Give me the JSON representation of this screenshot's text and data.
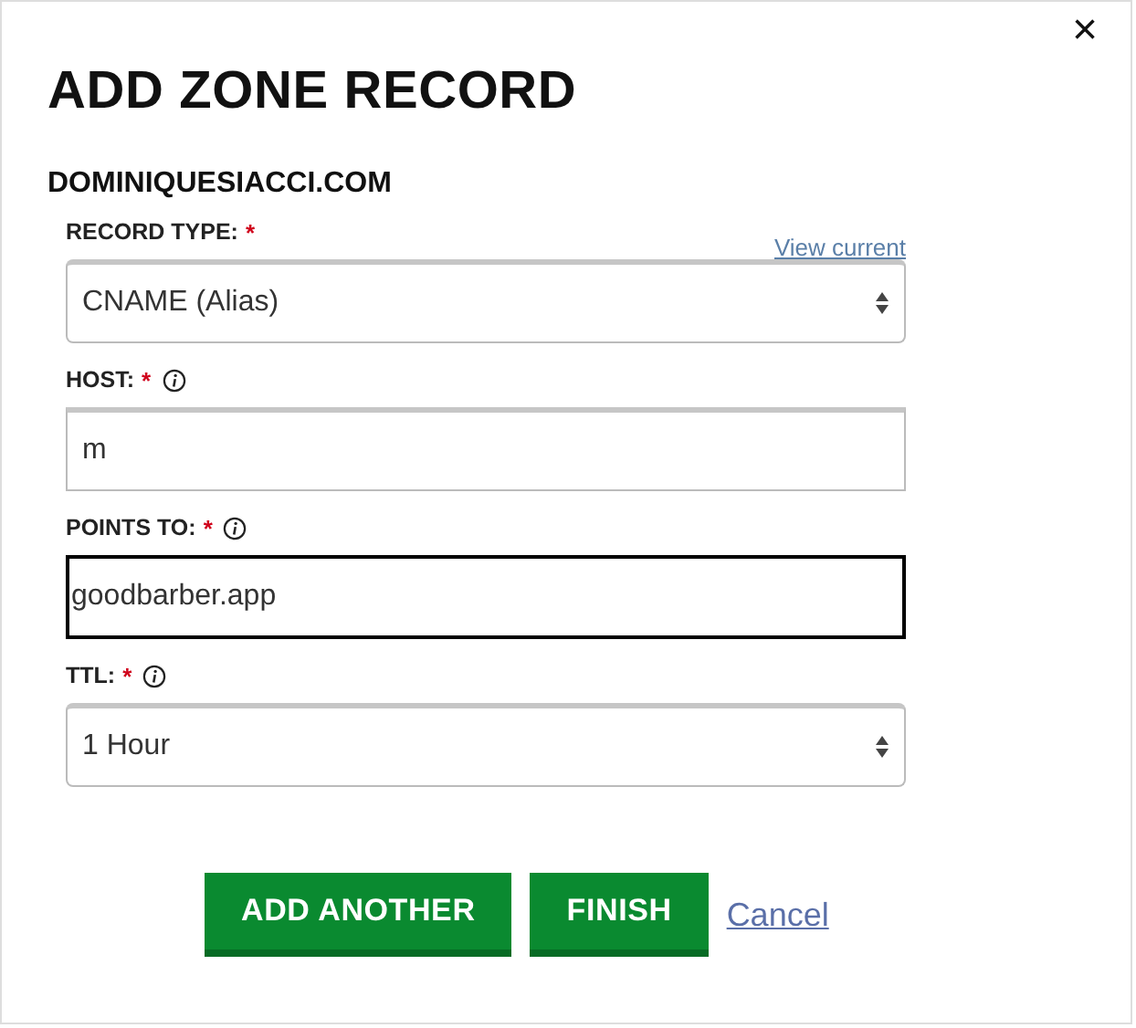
{
  "dialog": {
    "title": "ADD ZONE RECORD",
    "close": "×"
  },
  "domain": "DOMINIQUESIACCI.COM",
  "fields": [
    {
      "kind": "select",
      "label": "RECORD TYPE:",
      "required": "*",
      "info": false,
      "link": "View current",
      "value": "CNAME (Alias)",
      "focused": false
    },
    {
      "kind": "input",
      "label": "HOST:",
      "required": "*",
      "info": true,
      "value": "m",
      "focused": false
    },
    {
      "kind": "input",
      "label": "POINTS TO:",
      "required": "*",
      "info": true,
      "value": "goodbarber.app",
      "focused": true
    },
    {
      "kind": "select",
      "label": "TTL:",
      "required": "*",
      "info": true,
      "value": "1 Hour",
      "focused": false
    }
  ],
  "buttons": [
    {
      "kind": "primary",
      "label": "ADD ANOTHER"
    },
    {
      "kind": "primary",
      "label": "FINISH"
    },
    {
      "kind": "link",
      "label": "Cancel"
    }
  ]
}
